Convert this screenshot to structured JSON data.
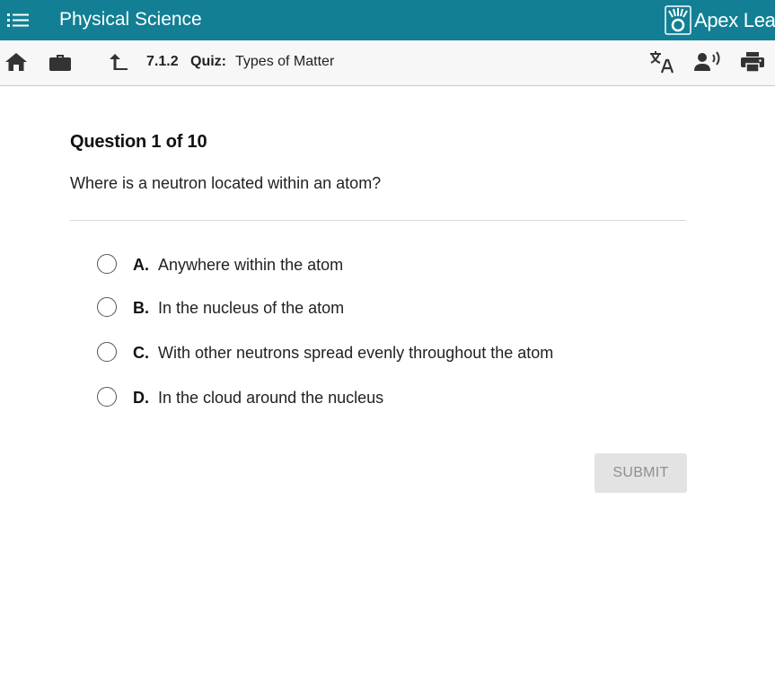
{
  "header": {
    "course_title": "Physical Science",
    "logo_text": "Apex Lear"
  },
  "toolbar": {
    "lesson_number": "7.1.2",
    "lesson_type": "Quiz:",
    "lesson_name": "Types of Matter"
  },
  "question": {
    "heading": "Question 1 of 10",
    "text": "Where is a neutron located within an atom?",
    "options": [
      {
        "letter": "A.",
        "text": "Anywhere within the atom"
      },
      {
        "letter": "B.",
        "text": "In the nucleus of the atom"
      },
      {
        "letter": "C.",
        "text": "With other neutrons spread evenly throughout the atom"
      },
      {
        "letter": "D.",
        "text": "In the cloud around the nucleus"
      }
    ]
  },
  "submit_label": "SUBMIT",
  "colors": {
    "header_bg": "#127f95",
    "toolbar_bg": "#f7f7f7",
    "submit_bg": "#e3e3e3",
    "submit_text": "#8f8f8f"
  },
  "icons": [
    "list-menu-icon",
    "apex-logo-icon",
    "home-icon",
    "briefcase-icon",
    "up-arrow-icon",
    "translate-icon",
    "read-aloud-icon",
    "print-icon"
  ]
}
